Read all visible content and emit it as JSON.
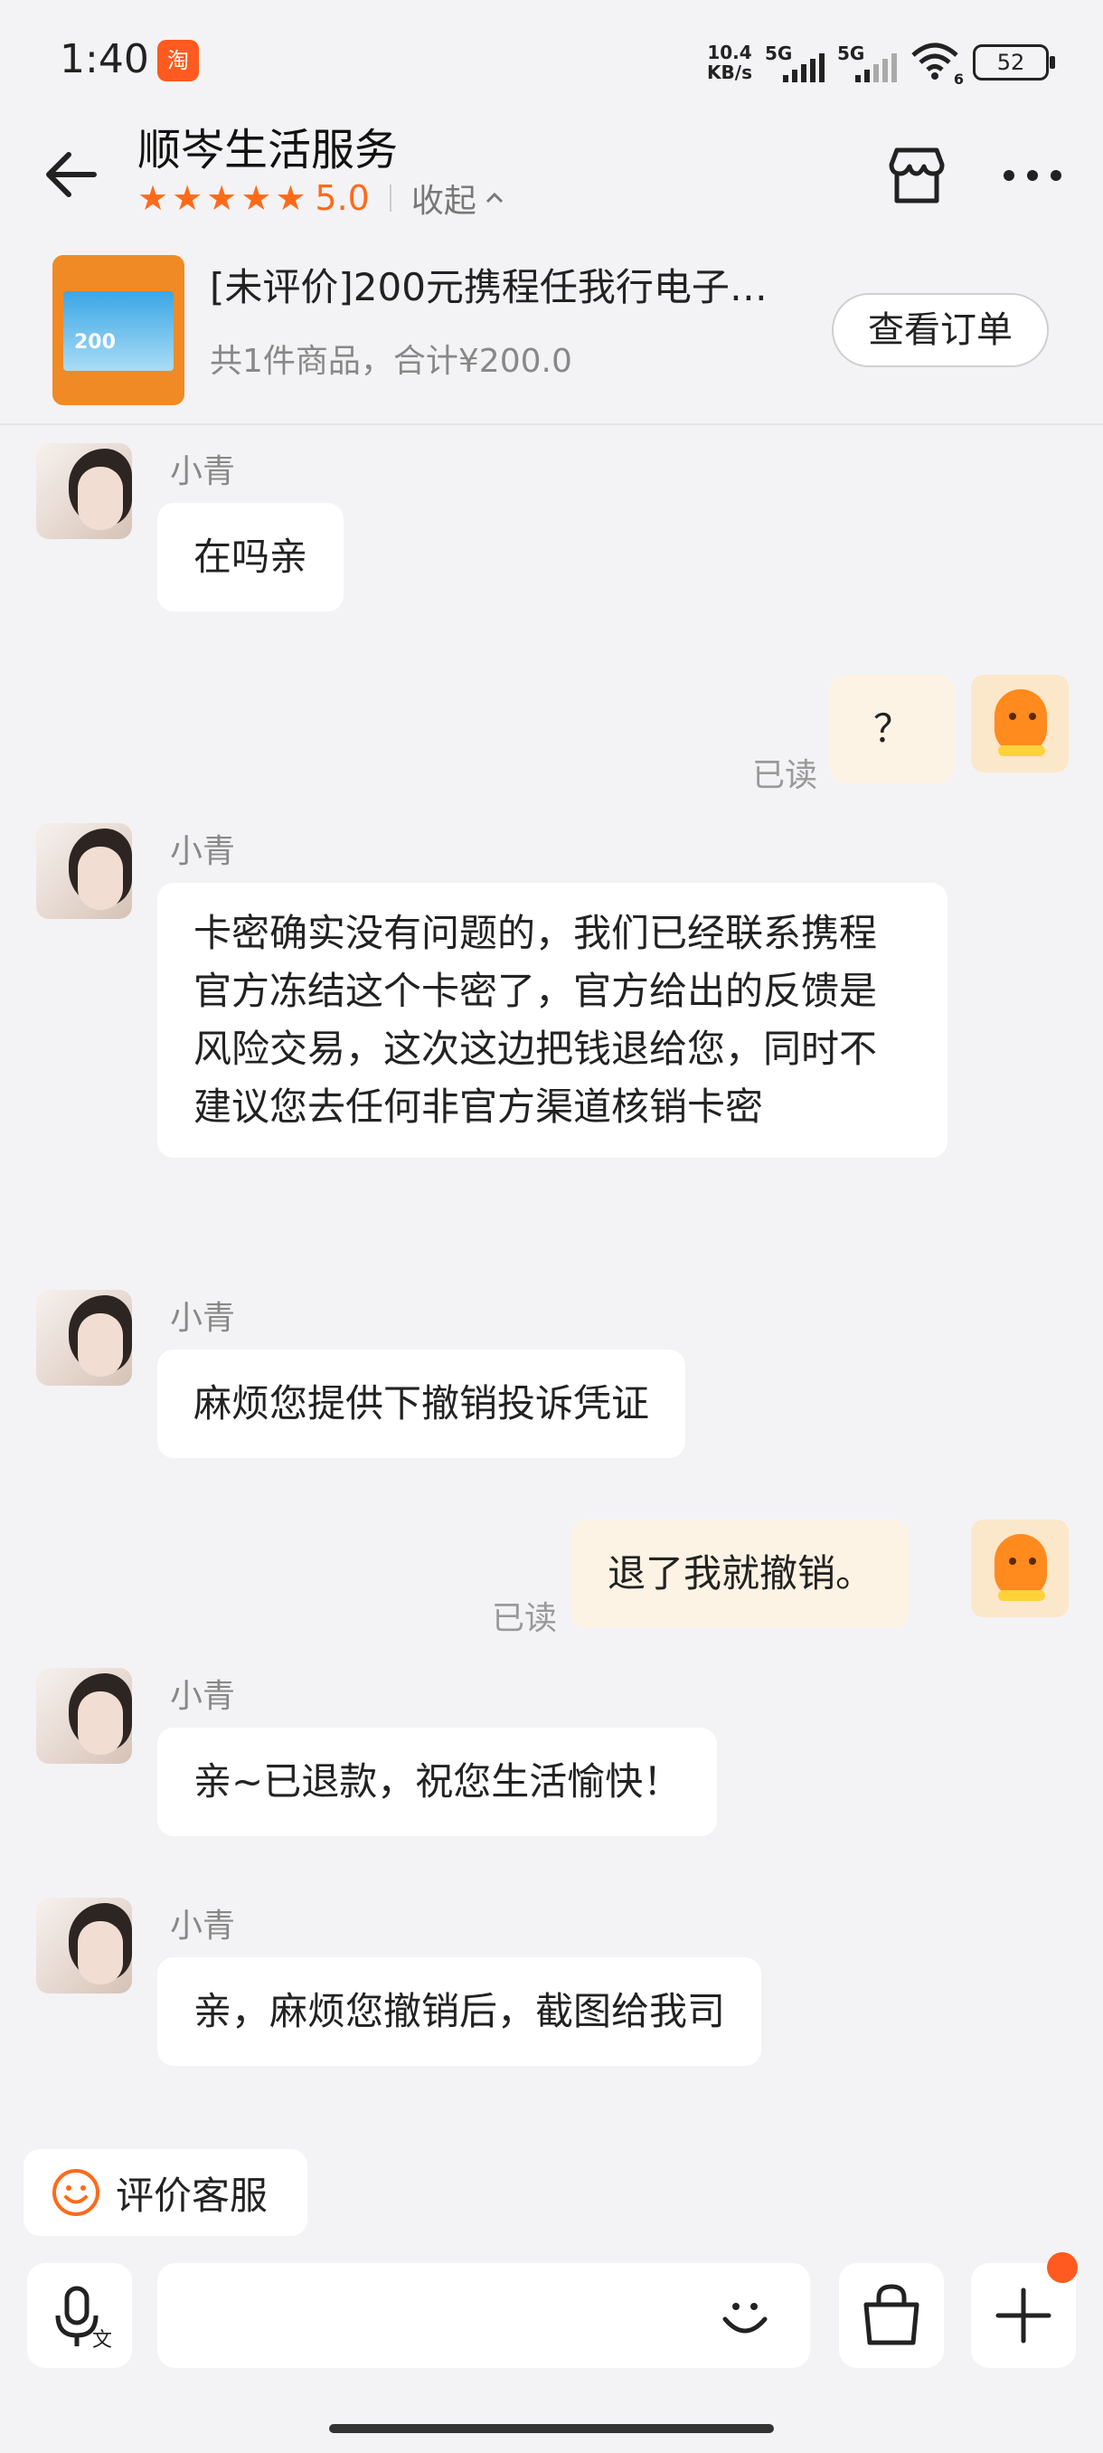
{
  "status_bar": {
    "time": "1:40",
    "app_icon_char": "淘",
    "net_speed_value": "10.4",
    "net_speed_unit": "KB/s",
    "sim1_label": "5G",
    "sim2_label": "5G",
    "wifi_label": "6",
    "battery_level": "52"
  },
  "header": {
    "shop_name": "顺岑生活服务",
    "rating_score": "5.0",
    "star_count": 5,
    "collapse_label": "收起"
  },
  "order": {
    "thumbnail_value": "200",
    "title": "[未评价]200元携程任我行电子…",
    "summary": "共1件商品，合计¥200.0",
    "view_order_label": "查看订单"
  },
  "messages": [
    {
      "from": "agent",
      "name": "小青",
      "text": "在吗亲"
    },
    {
      "from": "me",
      "text": "？",
      "status": "已读"
    },
    {
      "from": "agent",
      "name": "小青",
      "text": "卡密确实没有问题的，我们已经联系携程官方冻结这个卡密了，官方给出的反馈是风险交易，这次这边把钱退给您，同时不建议您去任何非官方渠道核销卡密"
    },
    {
      "from": "agent",
      "name": "小青",
      "text": "麻烦您提供下撤销投诉凭证"
    },
    {
      "from": "me",
      "text": "退了我就撤销。",
      "status": "已读"
    },
    {
      "from": "agent",
      "name": "小青",
      "text": "亲~已退款，祝您生活愉快！"
    },
    {
      "from": "agent",
      "name": "小青",
      "text": "亲，麻烦您撤销后，截图给我司"
    }
  ],
  "rate_service_label": "评价客服",
  "input": {
    "value": "",
    "placeholder": ""
  },
  "colors": {
    "accent": "#ff6a1a",
    "my_bubble": "#fdf3e4",
    "agent_bubble": "#ffffff",
    "background": "#f3f3f5"
  }
}
